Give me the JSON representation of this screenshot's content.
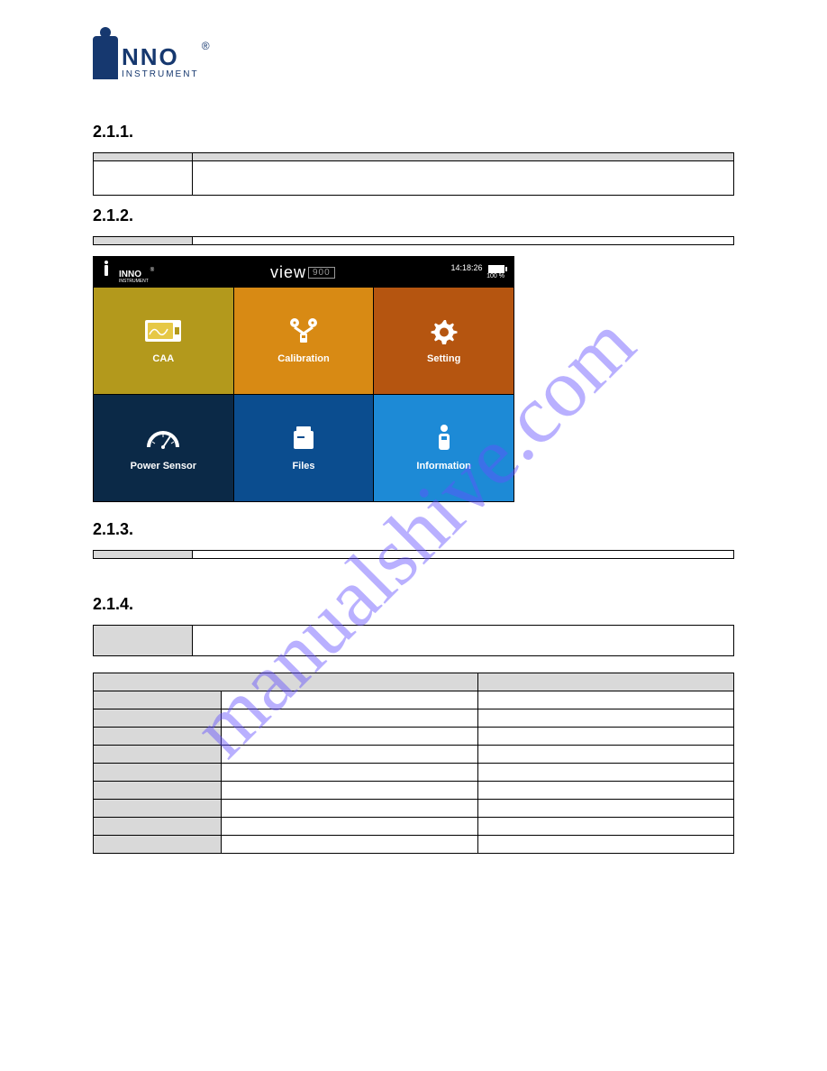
{
  "logo": {
    "top": "NNO",
    "bottom": "INSTRUMENT",
    "reg": "®"
  },
  "sections": {
    "s1": {
      "num": "2.1.1."
    },
    "s2": {
      "num": "2.1.2."
    },
    "s3": {
      "num": "2.1.3."
    },
    "s4": {
      "num": "2.1.4."
    }
  },
  "device": {
    "brand": "INNO",
    "brand_sub": "INSTRUMENT",
    "brand_reg": "®",
    "title_view": "view",
    "title_model": "900",
    "clock": "14:18:26",
    "battery": "100 %",
    "tiles": {
      "caa": "CAA",
      "calibration": "Calibration",
      "setting": "Setting",
      "power_sensor": "Power Sensor",
      "files": "Files",
      "information": "Information"
    }
  },
  "watermark": "manualshive.com"
}
